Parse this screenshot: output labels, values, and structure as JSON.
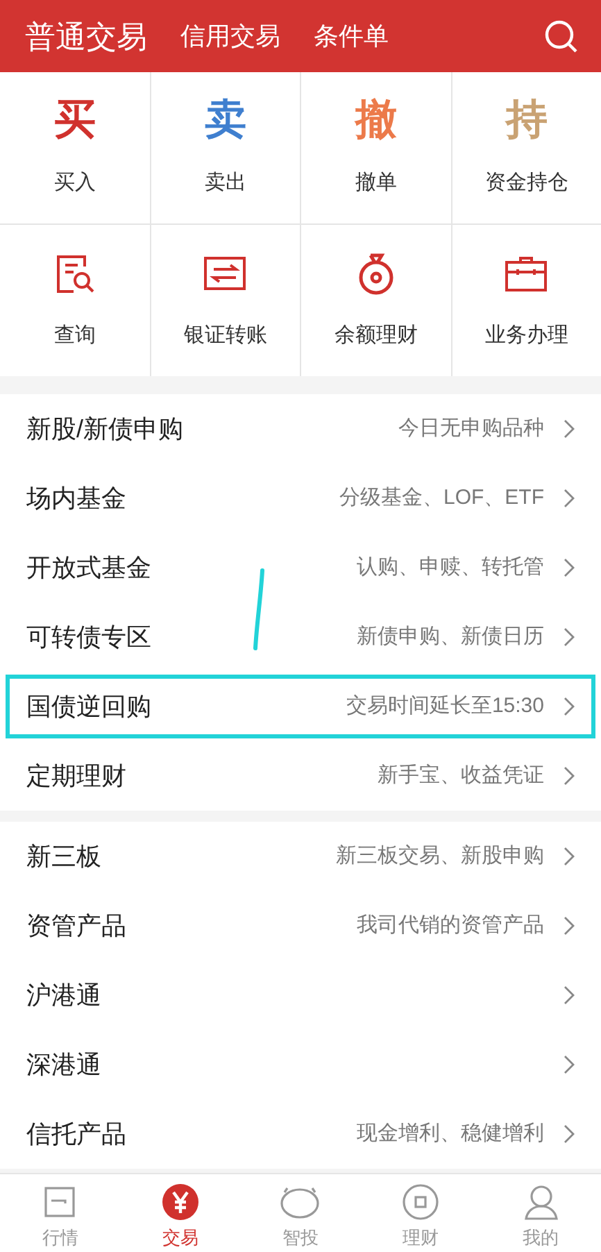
{
  "header": {
    "tabs": [
      {
        "label": "普通交易",
        "selected": true
      },
      {
        "label": "信用交易",
        "selected": false
      },
      {
        "label": "条件单",
        "selected": false
      }
    ]
  },
  "actions": [
    {
      "glyph": "买",
      "label": "买入",
      "color": "#d0312d",
      "kind": "glyph"
    },
    {
      "glyph": "卖",
      "label": "卖出",
      "color": "#3f7fcf",
      "kind": "glyph"
    },
    {
      "glyph": "撤",
      "label": "撤单",
      "color": "#ec7a4a",
      "kind": "glyph"
    },
    {
      "glyph": "持",
      "label": "资金持仓",
      "color": "#c9a273",
      "kind": "glyph"
    },
    {
      "label": "查询",
      "kind": "query"
    },
    {
      "label": "银证转账",
      "kind": "transfer"
    },
    {
      "label": "余额理财",
      "kind": "moneybag"
    },
    {
      "label": "业务办理",
      "kind": "briefcase"
    }
  ],
  "sections": [
    [
      {
        "title": "新股/新债申购",
        "hint": "今日无申购品种",
        "highlighted": false
      },
      {
        "title": "场内基金",
        "hint": "分级基金、LOF、ETF",
        "highlighted": false
      },
      {
        "title": "开放式基金",
        "hint": "认购、申赎、转托管",
        "highlighted": false
      },
      {
        "title": "可转债专区",
        "hint": "新债申购、新债日历",
        "highlighted": false
      },
      {
        "title": "国债逆回购",
        "hint": "交易时间延长至15:30",
        "highlighted": true
      },
      {
        "title": "定期理财",
        "hint": "新手宝、收益凭证",
        "highlighted": false
      }
    ],
    [
      {
        "title": "新三板",
        "hint": "新三板交易、新股申购",
        "highlighted": false
      },
      {
        "title": "资管产品",
        "hint": "我司代销的资管产品",
        "highlighted": false
      },
      {
        "title": "沪港通",
        "highlighted": false
      },
      {
        "title": "深港通",
        "highlighted": false
      },
      {
        "title": "信托产品",
        "hint": "现金增利、稳健增利",
        "highlighted": false
      }
    ]
  ],
  "bottom_nav": [
    {
      "label": "行情",
      "kind": "chart",
      "selected": false
    },
    {
      "label": "交易",
      "kind": "yen",
      "selected": true
    },
    {
      "label": "智投",
      "kind": "robot",
      "selected": false
    },
    {
      "label": "理财",
      "kind": "coin",
      "selected": false
    },
    {
      "label": "我的",
      "kind": "person",
      "selected": false
    }
  ]
}
